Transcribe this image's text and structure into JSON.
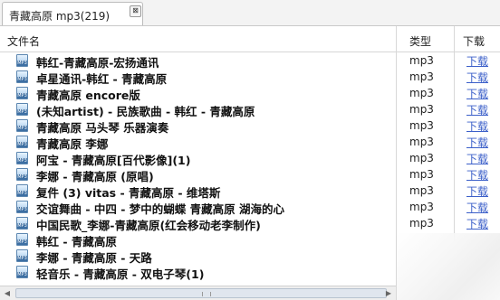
{
  "tab": {
    "label": "青藏高原 mp3(219)",
    "close_glyph": "⊠"
  },
  "columns": {
    "name": "文件名",
    "type": "类型",
    "download": "下载"
  },
  "rows": [
    {
      "name": "韩红-青藏高原-宏扬通讯",
      "type": "mp3",
      "link": "下载"
    },
    {
      "name": "卓星通讯-韩红 - 青藏高原",
      "type": "mp3",
      "link": "下载"
    },
    {
      "name": "青藏高原 encore版",
      "type": "mp3",
      "link": "下载"
    },
    {
      "name": "(未知artist) - 民族歌曲 - 韩红 - 青藏高原",
      "type": "mp3",
      "link": "下载"
    },
    {
      "name": "青藏高原 马头琴 乐器演奏",
      "type": "mp3",
      "link": "下载"
    },
    {
      "name": "青藏高原 李娜",
      "type": "mp3",
      "link": "下载"
    },
    {
      "name": "阿宝 - 青藏高原[百代影像](1)",
      "type": "mp3",
      "link": "下载"
    },
    {
      "name": "李娜 - 青藏高原 (原唱)",
      "type": "mp3",
      "link": "下载"
    },
    {
      "name": "复件 (3) vitas - 青藏高原 - 维塔斯",
      "type": "mp3",
      "link": "下载"
    },
    {
      "name": "交谊舞曲 - 中四 - 梦中的蝴蝶 青藏高原 湖海的心",
      "type": "mp3",
      "link": "下载"
    },
    {
      "name": "中国民歌_李娜-青藏高原(红会移动老李制作)",
      "type": "mp3",
      "link": "下载"
    },
    {
      "name": "韩红 - 青藏高原",
      "type": "",
      "link": ""
    },
    {
      "name": "李娜 - 青藏高原 - 天路",
      "type": "",
      "link": ""
    },
    {
      "name": "轻音乐 - 青藏高原 - 双电子琴(1)",
      "type": "",
      "link": ""
    }
  ],
  "scrollbar": {
    "left_arrow": "◀",
    "right_arrow": "▶"
  }
}
